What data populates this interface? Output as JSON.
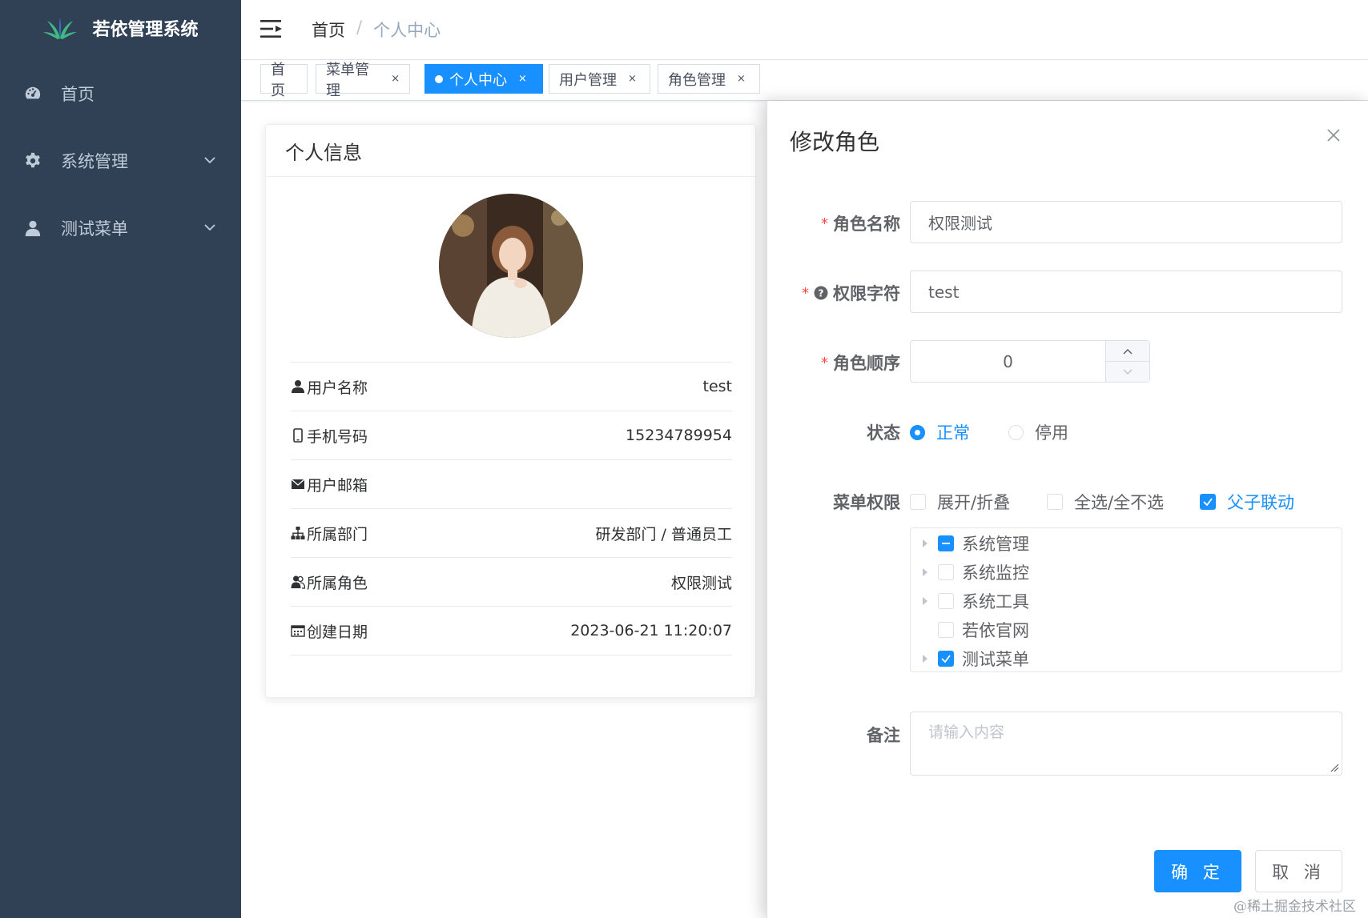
{
  "app": {
    "title": "若依管理系统"
  },
  "sidebar": {
    "items": [
      {
        "label": "首页",
        "icon": "dashboard-icon"
      },
      {
        "label": "系统管理",
        "icon": "gear-icon"
      },
      {
        "label": "测试菜单",
        "icon": "user-icon"
      }
    ]
  },
  "breadcrumb": {
    "home": "首页",
    "separator": "/",
    "current": "个人中心"
  },
  "tags": [
    {
      "label": "首页",
      "closable": false,
      "active": false
    },
    {
      "label": "菜单管理",
      "closable": true,
      "active": false
    },
    {
      "label": "个人中心",
      "closable": true,
      "active": true
    },
    {
      "label": "用户管理",
      "closable": true,
      "active": false
    },
    {
      "label": "角色管理",
      "closable": true,
      "active": false
    }
  ],
  "tag_close_glyph": "×",
  "profile": {
    "title": "个人信息",
    "rows": [
      {
        "label": "用户名称",
        "value": "test"
      },
      {
        "label": "手机号码",
        "value": "15234789954"
      },
      {
        "label": "用户邮箱",
        "value": ""
      },
      {
        "label": "所属部门",
        "value": "研发部门 / 普通员工"
      },
      {
        "label": "所属角色",
        "value": "权限测试"
      },
      {
        "label": "创建日期",
        "value": "2023-06-21 11:20:07"
      }
    ]
  },
  "dialog": {
    "title": "修改角色",
    "required_mark": "*",
    "role_name": {
      "label": "角色名称",
      "value": "权限测试"
    },
    "role_key": {
      "label": "权限字符",
      "value": "test"
    },
    "role_sort": {
      "label": "角色顺序",
      "value": "0"
    },
    "status": {
      "label": "状态",
      "options": [
        "正常",
        "停用"
      ],
      "selected": "正常"
    },
    "menu_perm": {
      "label": "菜单权限",
      "options": [
        {
          "label": "展开/折叠",
          "checked": false
        },
        {
          "label": "全选/全不选",
          "checked": false
        },
        {
          "label": "父子联动",
          "checked": true
        }
      ],
      "tree": [
        {
          "label": "系统管理",
          "state": "indeterminate",
          "has_children": true
        },
        {
          "label": "系统监控",
          "state": "unchecked",
          "has_children": true
        },
        {
          "label": "系统工具",
          "state": "unchecked",
          "has_children": true
        },
        {
          "label": "若依官网",
          "state": "unchecked",
          "has_children": false
        },
        {
          "label": "测试菜单",
          "state": "checked",
          "has_children": true
        }
      ]
    },
    "remark": {
      "label": "备注",
      "placeholder": "请输入内容"
    },
    "confirm": "确 定",
    "cancel": "取 消"
  },
  "watermark": "@稀土掘金技术社区",
  "colors": {
    "sidebar_bg": "#304156",
    "primary": "#1890ff",
    "required": "#ff4949"
  }
}
